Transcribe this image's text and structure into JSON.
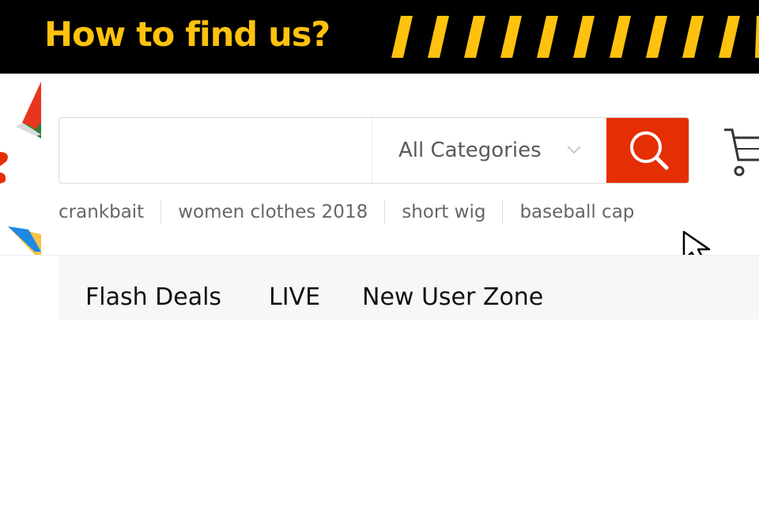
{
  "banner": {
    "title": "How to find us?",
    "accent_color": "#ffc20e"
  },
  "search": {
    "value": "",
    "placeholder": "",
    "category_label": "All Categories",
    "button_color": "#e62e04"
  },
  "hot_keywords": [
    "crankbait",
    "women clothes 2018",
    "short wig",
    "baseball cap"
  ],
  "nav": {
    "items": [
      "Flash Deals",
      "LIVE",
      "New User Zone"
    ]
  },
  "icons": {
    "search": "search-icon",
    "chevron": "chevron-down-icon",
    "cart": "cart-icon",
    "cursor": "mouse-pointer-icon"
  }
}
